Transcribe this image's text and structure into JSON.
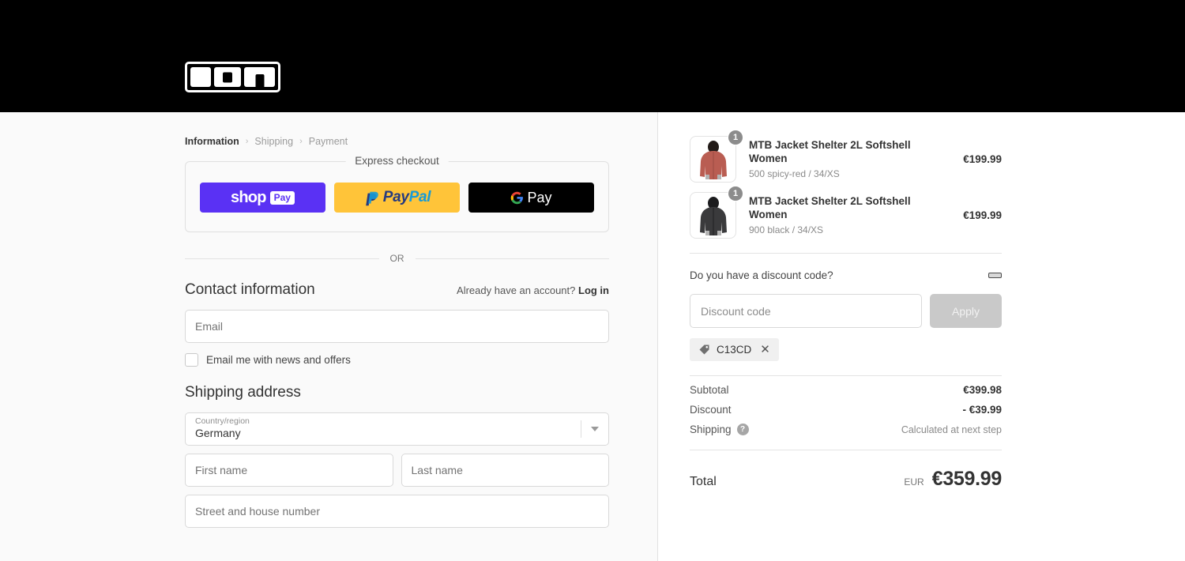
{
  "brand": {
    "logo_text": "ION",
    "logo_icon": "ion-logo"
  },
  "breadcrumb": {
    "items": [
      {
        "label": "Information",
        "active": true
      },
      {
        "label": "Shipping",
        "active": false
      },
      {
        "label": "Payment",
        "active": false
      }
    ],
    "separator": "›"
  },
  "express": {
    "legend": "Express checkout",
    "buttons": [
      {
        "id": "shop-pay",
        "word": "shop",
        "chip": "Pay",
        "bg": "#5a31f4"
      },
      {
        "id": "paypal",
        "word_a": "Pay",
        "word_b": "Pal",
        "bg": "#ffc439"
      },
      {
        "id": "google-pay",
        "word": "Pay",
        "bg": "#000000"
      }
    ]
  },
  "or_divider": "OR",
  "contact": {
    "title": "Contact information",
    "account_note": "Already have an account?",
    "login_label": "Log in",
    "email_placeholder": "Email",
    "email_value": "",
    "newsletter_label": "Email me with news and offers",
    "newsletter_checked": false
  },
  "shipping_address": {
    "title": "Shipping address",
    "country_label": "Country/region",
    "country_value": "Germany",
    "first_name_placeholder": "First name",
    "last_name_placeholder": "Last name",
    "street_placeholder": "Street and house number"
  },
  "order_summary": {
    "items": [
      {
        "title": "MTB Jacket Shelter 2L Softshell Women",
        "variant": "500 spicy-red / 34/XS",
        "price": "€199.99",
        "quantity": "1",
        "color_hex": "#b95d52",
        "thumb_icon": "jacket-red-thumbnail"
      },
      {
        "title": "MTB Jacket Shelter 2L Softshell Women",
        "variant": "900 black / 34/XS",
        "price": "€199.99",
        "quantity": "1",
        "color_hex": "#3a3a3c",
        "thumb_icon": "jacket-black-thumbnail"
      }
    ],
    "discount": {
      "question": "Do you have a discount code?",
      "collapse_icon": "minus-collapse-icon",
      "input_placeholder": "Discount code",
      "input_value": "",
      "apply_label": "Apply",
      "applied_codes": [
        {
          "code": "C13CD",
          "tag_icon": "tag-icon",
          "remove_icon": "close-icon"
        }
      ]
    },
    "totals": [
      {
        "label": "Subtotal",
        "value": "€399.98",
        "muted": false,
        "help": false
      },
      {
        "label": "Discount",
        "value": "- €39.99",
        "muted": false,
        "help": false
      },
      {
        "label": "Shipping",
        "value": "Calculated at next step",
        "muted": true,
        "help": true,
        "help_icon": "question-mark-icon"
      }
    ],
    "grand_total": {
      "label": "Total",
      "currency": "EUR",
      "amount": "€359.99"
    }
  }
}
